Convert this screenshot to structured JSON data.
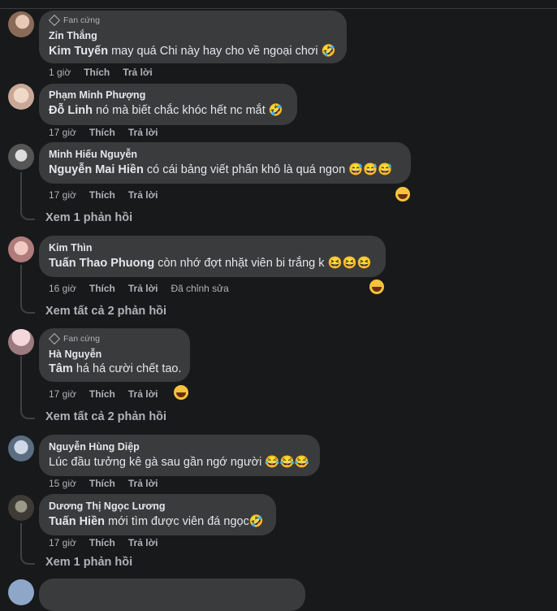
{
  "badge_label": "Fan cứng",
  "comments": [
    {
      "author": "Zin Thắng",
      "mention": "Kim Tuyến",
      "text": "may quá Chi này hay cho về ngoại chơi",
      "emojis": "🤣",
      "time": "1 giờ",
      "like": "Thích",
      "reply": "Trả lời"
    },
    {
      "author": "Phạm Minh Phượng",
      "mention": "Đỗ Linh",
      "text": "nó mà biết chắc khóc hết nc mắt",
      "emojis": "🤣",
      "time": "17 giờ",
      "like": "Thích",
      "reply": "Trả lời"
    },
    {
      "author": "Minh Hiếu Nguyễn",
      "mention": "Nguyễn Mai Hiền",
      "text": "có cái bảng viết phấn khô là quá ngon",
      "emojis": "😅😅😅",
      "time": "17 giờ",
      "like": "Thích",
      "reply": "Trả lời",
      "replies_link": "Xem 1 phản hồi"
    },
    {
      "author": "Kim Thìn",
      "mention": "Tuấn Thao Phuong",
      "text": "còn nhớ đợt nhặt viên bi trắng k",
      "emojis": "😆😆😆",
      "time": "16 giờ",
      "like": "Thích",
      "reply": "Trả lời",
      "edited": "Đã chỉnh sửa",
      "replies_link": "Xem tất cả 2 phản hồi"
    },
    {
      "author": "Hà Nguyễn",
      "mention": "Tâm",
      "text": "há há cười chết tao.",
      "emojis": "",
      "time": "17 giờ",
      "like": "Thích",
      "reply": "Trả lời",
      "replies_link": "Xem tất cả 2 phản hồi"
    },
    {
      "author": "Nguyễn Hùng Diệp",
      "mention": "",
      "text": "Lúc đầu tưởng kê gà sau gần ngớ người",
      "emojis": "😂😂😂",
      "time": "15 giờ",
      "like": "Thích",
      "reply": "Trả lời"
    },
    {
      "author": "Dương Thị Ngọc Lương",
      "mention": "Tuấn Hiền",
      "text": "mới tìm được viên đá ngọc",
      "emojis": "🤣",
      "time": "17 giờ",
      "like": "Thích",
      "reply": "Trả lời",
      "replies_link": "Xem 1 phản hồi"
    }
  ]
}
